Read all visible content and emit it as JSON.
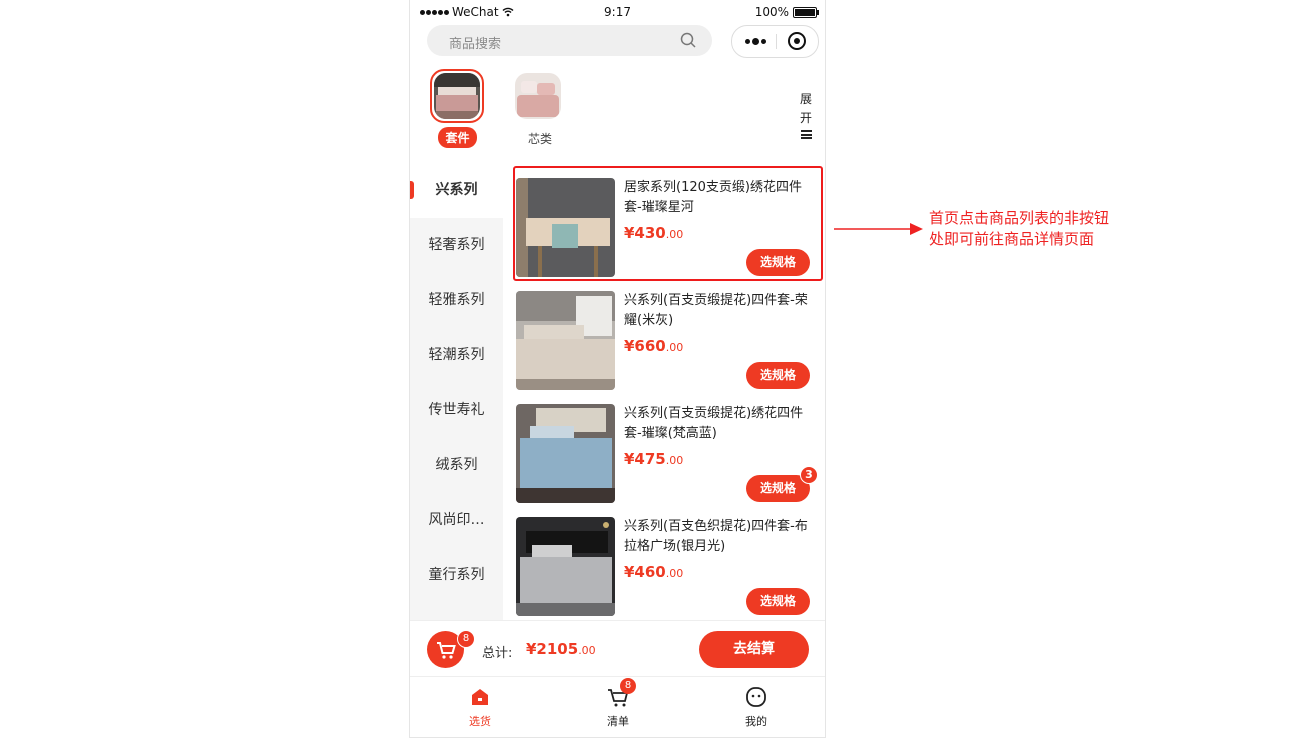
{
  "status_bar": {
    "carrier": "WeChat",
    "time": "9:17",
    "battery": "100%"
  },
  "search": {
    "placeholder": "商品搜索"
  },
  "top_categories": [
    {
      "label": "套件",
      "selected": true
    },
    {
      "label": "芯类",
      "selected": false
    }
  ],
  "expand": {
    "chars": [
      "展",
      "开"
    ]
  },
  "sidebar": {
    "items": [
      {
        "label": "兴系列",
        "active": true
      },
      {
        "label": "轻奢系列"
      },
      {
        "label": "轻雅系列"
      },
      {
        "label": "轻潮系列"
      },
      {
        "label": "传世寿礼"
      },
      {
        "label": "绒系列"
      },
      {
        "label": "风尚印…"
      },
      {
        "label": "童行系列"
      }
    ]
  },
  "products": [
    {
      "name": "居家系列(120支贡缎)绣花四件套-璀璨星河",
      "price_main": "¥430",
      "price_dec": ".00",
      "button": "选规格",
      "badge": ""
    },
    {
      "name": "兴系列(百支贡缎提花)四件套-荣耀(米灰)",
      "price_main": "¥660",
      "price_dec": ".00",
      "button": "选规格",
      "badge": ""
    },
    {
      "name": "兴系列(百支贡缎提花)绣花四件套-璀璨(梵高蓝)",
      "price_main": "¥475",
      "price_dec": ".00",
      "button": "选规格",
      "badge": "3"
    },
    {
      "name": "兴系列(百支色织提花)四件套-布拉格广场(银月光)",
      "price_main": "¥460",
      "price_dec": ".00",
      "button": "选规格",
      "badge": ""
    }
  ],
  "total_bar": {
    "cart_count": "8",
    "label": "总计:",
    "total_main": "¥2105",
    "total_dec": ".00",
    "checkout": "去结算"
  },
  "tabbar": {
    "tabs": [
      {
        "label": "选货",
        "icon": "home-icon",
        "active": true
      },
      {
        "label": "清单",
        "icon": "cart-icon",
        "badge": "8"
      },
      {
        "label": "我的",
        "icon": "face-icon"
      }
    ]
  },
  "annotation": {
    "line1": "首页点击商品列表的非按钮",
    "line2": "处即可前往商品详情页面"
  },
  "colors": {
    "accent": "#ee3a23",
    "annotation": "#ee2222"
  }
}
